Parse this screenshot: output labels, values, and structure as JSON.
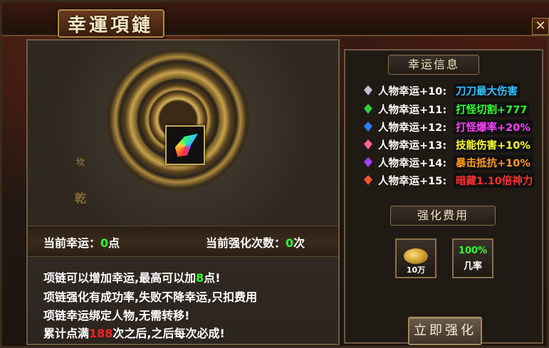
{
  "window": {
    "title": "幸運項鏈",
    "close_label": "✕"
  },
  "art": {
    "runes": [
      "乾",
      "乾",
      "坎"
    ]
  },
  "stats": {
    "current_luck_label": "当前幸运：",
    "current_luck_value": "0",
    "current_luck_unit": "点",
    "current_count_label": "当前强化次数：",
    "current_count_value": "0",
    "current_count_unit": "次"
  },
  "description": {
    "line1_pre": "项链可以增加幸运,最高可以加",
    "line1_num": "8",
    "line1_post": "点!",
    "line2": "项链强化有成功率,失败不降幸运,只扣费用",
    "line3": "项链幸运绑定人物,无需转移!",
    "line4_pre": "累计点满",
    "line4_num": "188",
    "line4_post": "次之后,之后每次必成!"
  },
  "luck_info": {
    "header": "幸运信息",
    "rows": [
      {
        "label": "人物幸运+10:",
        "reward": "刀刀最大伤害",
        "color": "#30c0ff",
        "gem": "#c0c0d0"
      },
      {
        "label": "人物幸运+11:",
        "reward": "打怪切割+777",
        "color": "#30ff30",
        "gem": "#30d040"
      },
      {
        "label": "人物幸运+12:",
        "reward": "打怪爆率+20%",
        "color": "#ff40ff",
        "gem": "#3080ff"
      },
      {
        "label": "人物幸运+13:",
        "reward": "技能伤害+10%",
        "color": "#ffff30",
        "gem": "#ff60a0"
      },
      {
        "label": "人物幸运+14:",
        "reward": "暴击抵抗+10%",
        "color": "#ff9a20",
        "gem": "#a040ff"
      },
      {
        "label": "人物幸运+15:",
        "reward": "暗藏1.10倍神力",
        "color": "#ff3030",
        "gem": "#ff5030"
      }
    ]
  },
  "cost": {
    "header": "强化费用",
    "gold_amount": "10万",
    "rate_value": "100%",
    "rate_label": "几率"
  },
  "enhance_button": "立即强化"
}
